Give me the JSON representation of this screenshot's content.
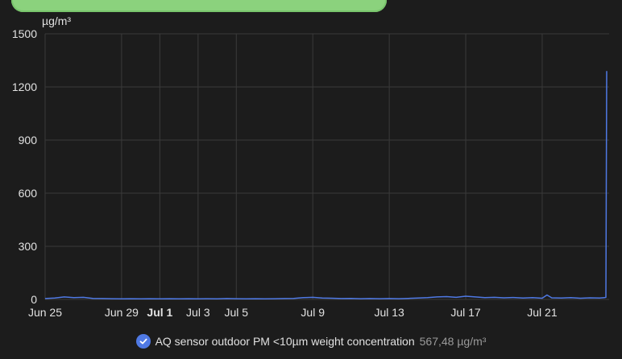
{
  "colors": {
    "background": "#1c1c1c",
    "grid": "#3a3a3a",
    "axis_text": "#e1e1e1",
    "series": "#4f79e4",
    "top_bar": "#8bd27d"
  },
  "legend": {
    "label": "AQ sensor outdoor PM <10µm weight concentration",
    "value": "567,48 µg/m³",
    "icon": "checkmark-circle-icon"
  },
  "chart_data": {
    "type": "line",
    "ylabel": "µg/m³",
    "ylim": [
      0,
      1500
    ],
    "yticks": [
      0,
      300,
      600,
      900,
      1200,
      1500
    ],
    "grid": true,
    "legend_position": "bottom-center",
    "xticks": [
      {
        "label": "Jun 25",
        "date": "2023-06-25",
        "bold": false
      },
      {
        "label": "Jun 29",
        "date": "2023-06-29",
        "bold": false
      },
      {
        "label": "Jul 1",
        "date": "2023-07-01",
        "bold": true
      },
      {
        "label": "Jul 3",
        "date": "2023-07-03",
        "bold": false
      },
      {
        "label": "Jul 5",
        "date": "2023-07-05",
        "bold": false
      },
      {
        "label": "Jul 9",
        "date": "2023-07-09",
        "bold": false
      },
      {
        "label": "Jul 13",
        "date": "2023-07-13",
        "bold": false
      },
      {
        "label": "Jul 17",
        "date": "2023-07-17",
        "bold": false
      },
      {
        "label": "Jul 21",
        "date": "2023-07-21",
        "bold": false
      }
    ],
    "series": [
      {
        "name": "AQ sensor outdoor PM <10µm weight concentration",
        "x": [
          "2023-06-25T00:00",
          "2023-06-25T12:00",
          "2023-06-26T00:00",
          "2023-06-26T12:00",
          "2023-06-27T00:00",
          "2023-06-27T12:00",
          "2023-06-28T00:00",
          "2023-06-28T12:00",
          "2023-06-29T00:00",
          "2023-06-29T12:00",
          "2023-06-30T00:00",
          "2023-06-30T12:00",
          "2023-07-01T00:00",
          "2023-07-01T12:00",
          "2023-07-02T00:00",
          "2023-07-02T12:00",
          "2023-07-03T00:00",
          "2023-07-03T12:00",
          "2023-07-04T00:00",
          "2023-07-04T12:00",
          "2023-07-05T00:00",
          "2023-07-05T12:00",
          "2023-07-06T00:00",
          "2023-07-06T12:00",
          "2023-07-07T00:00",
          "2023-07-07T12:00",
          "2023-07-08T00:00",
          "2023-07-08T12:00",
          "2023-07-09T00:00",
          "2023-07-09T12:00",
          "2023-07-10T00:00",
          "2023-07-10T12:00",
          "2023-07-11T00:00",
          "2023-07-11T12:00",
          "2023-07-12T00:00",
          "2023-07-12T12:00",
          "2023-07-13T00:00",
          "2023-07-13T12:00",
          "2023-07-14T00:00",
          "2023-07-14T12:00",
          "2023-07-15T00:00",
          "2023-07-15T12:00",
          "2023-07-16T00:00",
          "2023-07-16T12:00",
          "2023-07-17T00:00",
          "2023-07-17T12:00",
          "2023-07-18T00:00",
          "2023-07-18T12:00",
          "2023-07-19T00:00",
          "2023-07-19T12:00",
          "2023-07-20T00:00",
          "2023-07-20T12:00",
          "2023-07-21T00:00",
          "2023-07-21T06:00",
          "2023-07-21T12:00",
          "2023-07-22T00:00",
          "2023-07-22T12:00",
          "2023-07-23T00:00",
          "2023-07-23T12:00",
          "2023-07-24T00:00",
          "2023-07-24T06:00",
          "2023-07-24T08:00",
          "2023-07-24T09:00"
        ],
        "y": [
          5,
          8,
          14,
          10,
          12,
          6,
          5,
          4,
          3,
          4,
          3,
          4,
          3,
          4,
          3,
          4,
          3,
          4,
          3,
          5,
          4,
          3,
          4,
          3,
          4,
          5,
          6,
          10,
          12,
          8,
          7,
          5,
          6,
          4,
          5,
          4,
          5,
          4,
          6,
          8,
          10,
          14,
          16,
          12,
          18,
          14,
          10,
          12,
          9,
          11,
          8,
          10,
          7,
          25,
          9,
          8,
          10,
          7,
          9,
          8,
          10,
          12,
          1290
        ]
      }
    ]
  }
}
